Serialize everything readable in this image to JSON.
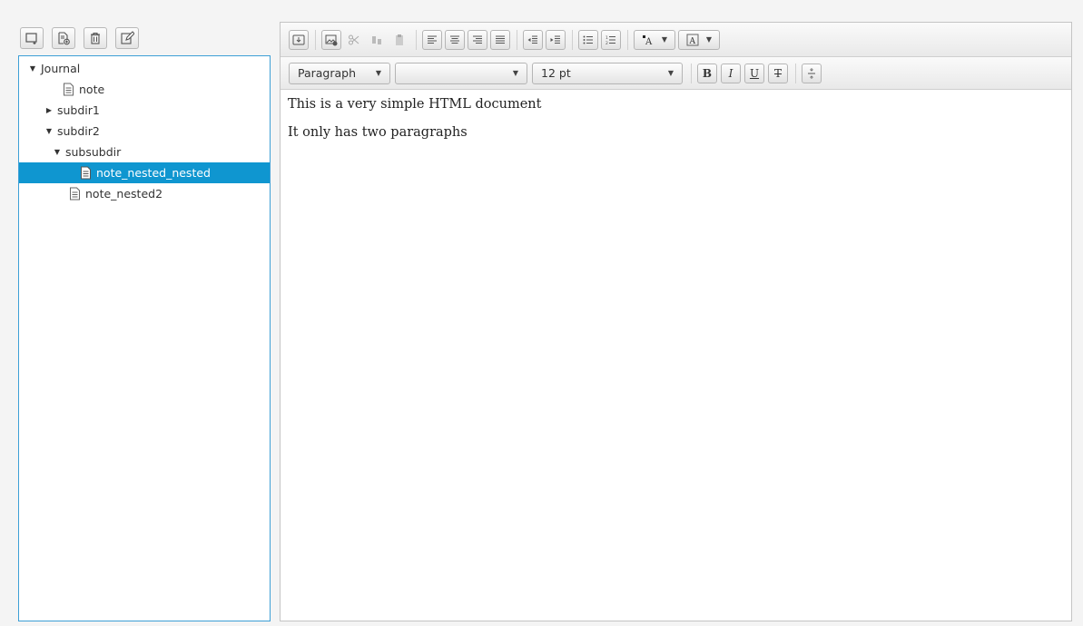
{
  "left_toolbar": {
    "icons": [
      "new-folder-icon",
      "new-note-icon",
      "delete-icon",
      "edit-icon"
    ]
  },
  "tree": {
    "items": [
      {
        "label": "Journal",
        "type": "folder",
        "expanded": true,
        "depth": 0
      },
      {
        "label": "note",
        "type": "file",
        "depth": 1
      },
      {
        "label": "subdir1",
        "type": "folder",
        "expanded": false,
        "depth": 1
      },
      {
        "label": "subdir2",
        "type": "folder",
        "expanded": true,
        "depth": 1
      },
      {
        "label": "subsubdir",
        "type": "folder",
        "expanded": true,
        "depth": 2
      },
      {
        "label": "note_nested_nested",
        "type": "file",
        "depth": 3,
        "selected": true
      },
      {
        "label": "note_nested2",
        "type": "file",
        "depth": 2
      }
    ]
  },
  "editor": {
    "format_combo": "Paragraph",
    "font_family_combo": "",
    "font_size_combo": "12 pt",
    "bold_label": "B",
    "italic_label": "I",
    "underline_label": "U",
    "strike_label": "T",
    "paragraphs": [
      "This is a very simple HTML document",
      "It only has two paragraphs"
    ]
  },
  "colors": {
    "selection": "#0f96d0",
    "focus_border": "#3d9fd6"
  }
}
